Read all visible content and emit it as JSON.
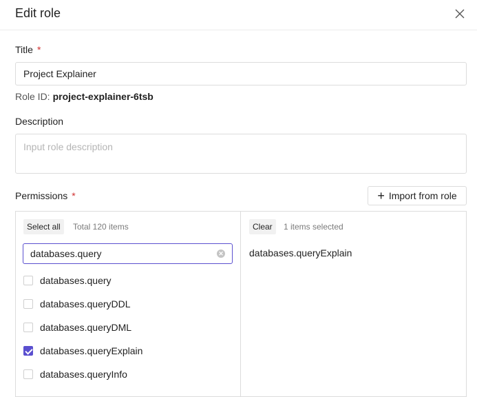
{
  "header": {
    "title": "Edit role"
  },
  "form": {
    "title_label": "Title",
    "required_mark": "*",
    "title_value": "Project Explainer",
    "role_id_label": "Role ID:",
    "role_id_value": "project-explainer-6tsb",
    "description_label": "Description",
    "description_placeholder": "Input role description",
    "permissions_label": "Permissions",
    "import_button": "Import from role"
  },
  "permissions": {
    "left": {
      "select_all": "Select all",
      "total": "Total 120 items",
      "search_value": "databases.query",
      "options": [
        {
          "label": "databases.query",
          "checked": false
        },
        {
          "label": "databases.queryDDL",
          "checked": false
        },
        {
          "label": "databases.queryDML",
          "checked": false
        },
        {
          "label": "databases.queryExplain",
          "checked": true
        },
        {
          "label": "databases.queryInfo",
          "checked": false
        }
      ]
    },
    "right": {
      "clear": "Clear",
      "selected_count": "1 items selected",
      "items": [
        "databases.queryExplain"
      ]
    }
  },
  "colors": {
    "accent": "#5a4fcf",
    "required": "#d03030"
  }
}
